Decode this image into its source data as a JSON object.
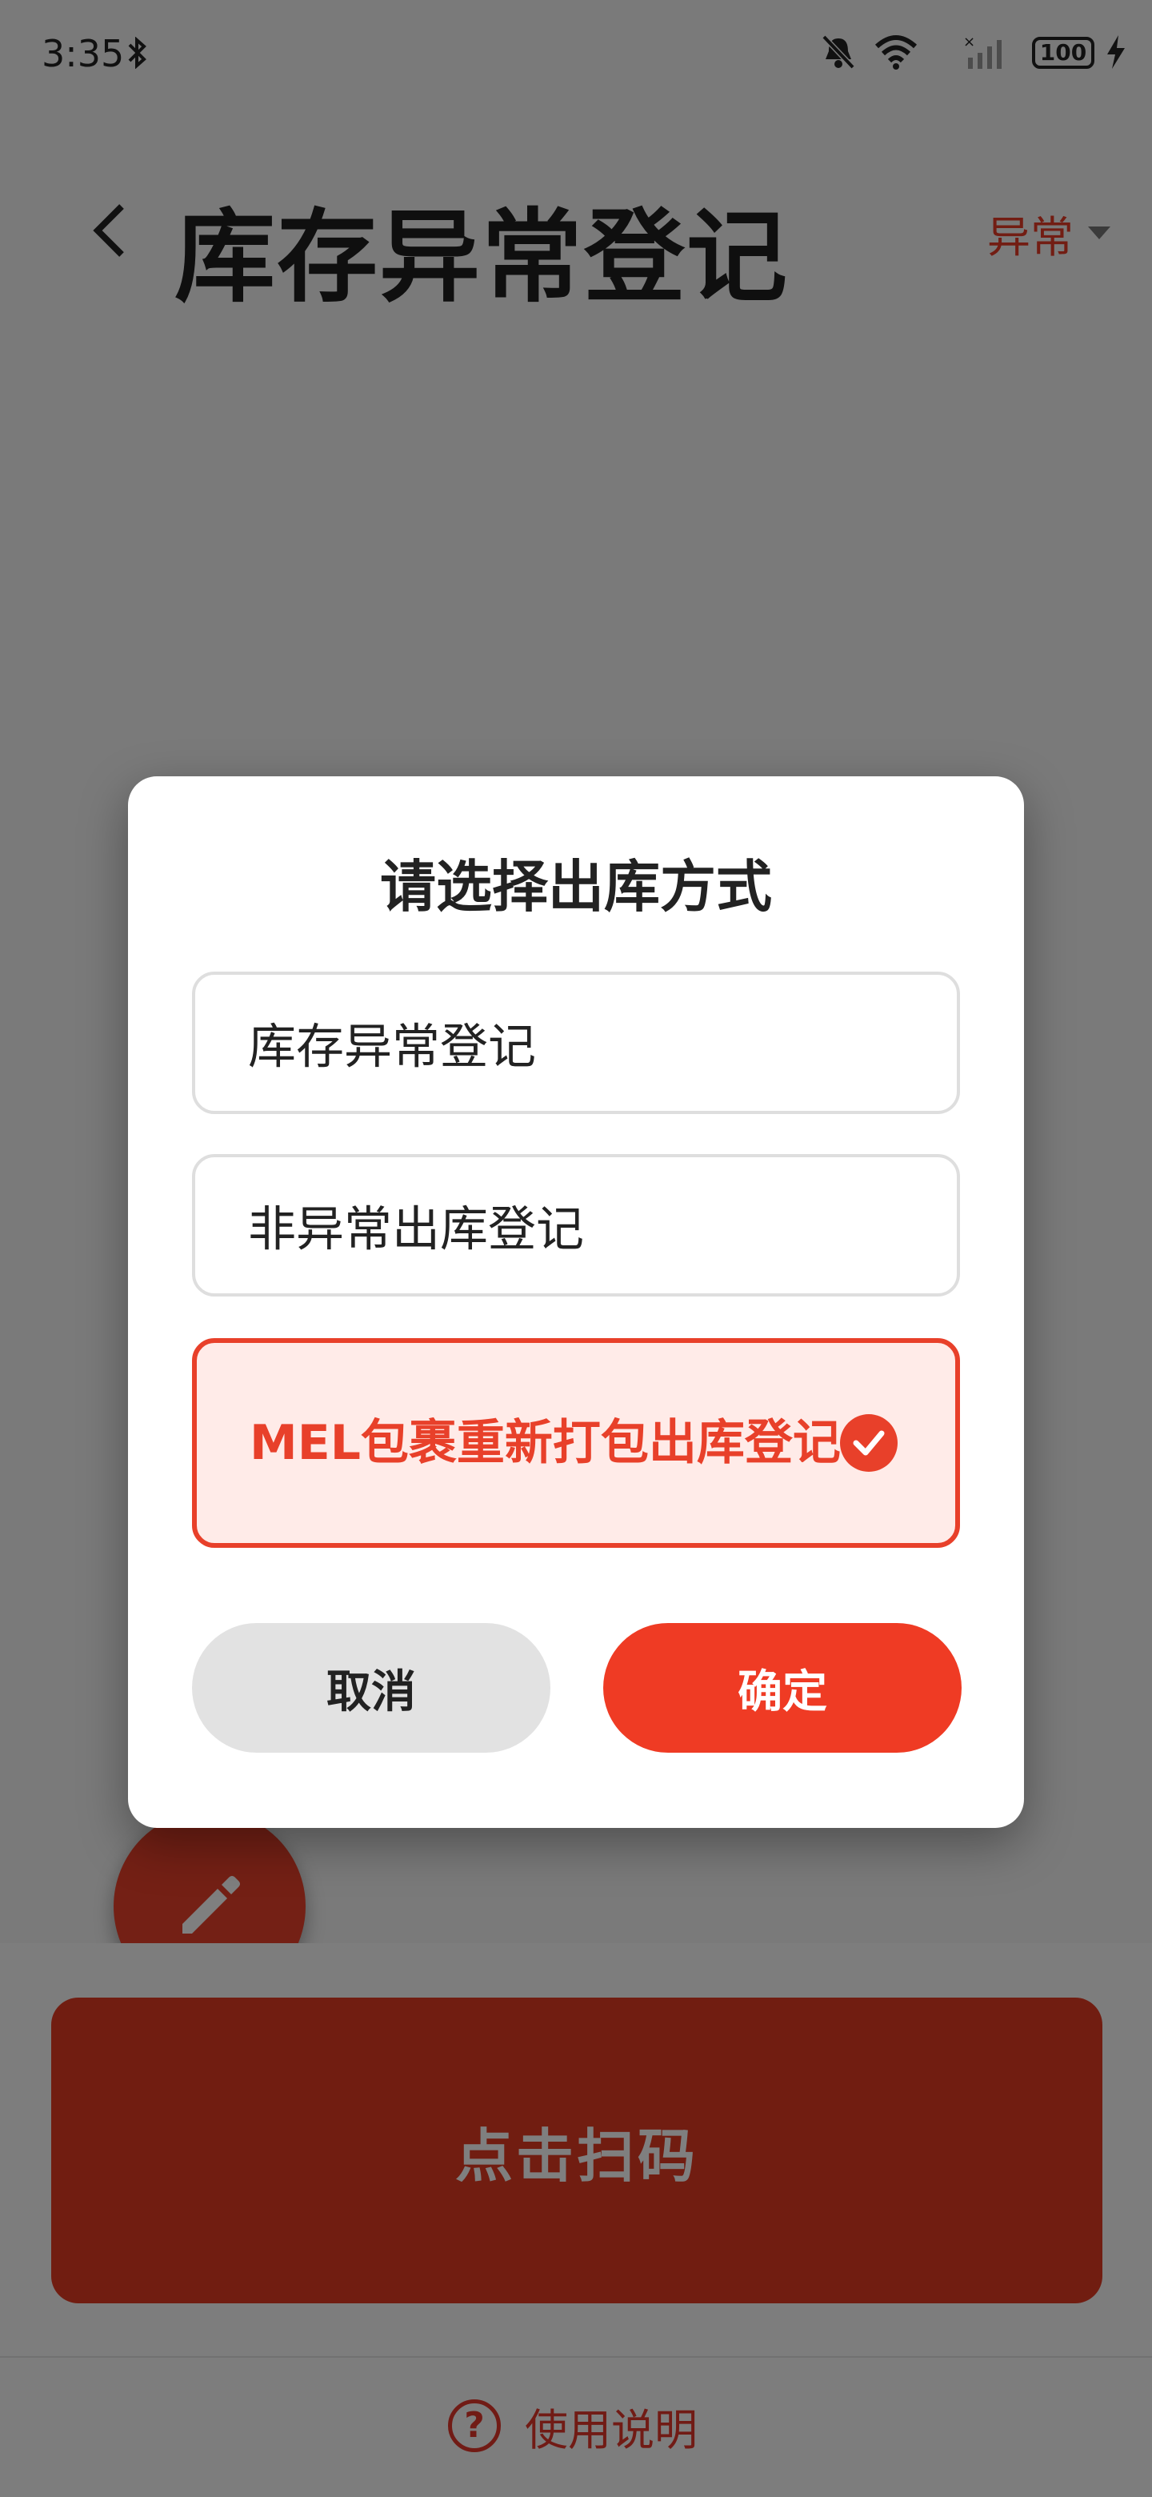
{
  "status_bar": {
    "time": "3:35",
    "battery": "100",
    "icons": [
      "bluetooth-icon",
      "mute-icon",
      "wifi-icon",
      "signal-icon",
      "battery-icon",
      "charging-icon"
    ]
  },
  "header": {
    "title": "库存异常登记",
    "filter_label": "异常"
  },
  "main": {
    "scan_button_label": "点击扫码",
    "help_label": "使用说明",
    "help_icon_glyph": "?"
  },
  "dialog": {
    "title": "请选择出库方式",
    "options": [
      {
        "label": "库存异常登记",
        "selected": false
      },
      {
        "label": "非异常出库登记",
        "selected": false
      },
      {
        "label": "MEL包裹重新打包出库登记",
        "selected": true
      }
    ],
    "cancel_label": "取消",
    "confirm_label": "确定"
  },
  "colors": {
    "accent": "#e8402a",
    "selected_bg": "#ffebe8",
    "overlay": "rgba(0,0,0,0.5)"
  }
}
